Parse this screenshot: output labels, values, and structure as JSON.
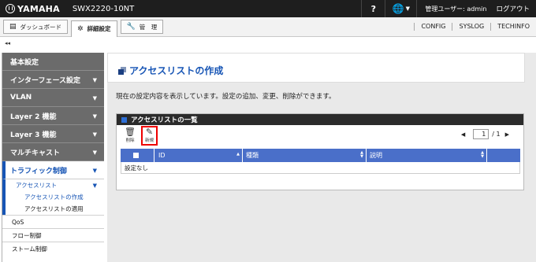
{
  "header": {
    "brand": "YAMAHA",
    "model": "SWX2220-10NT",
    "help": "?",
    "user_label": "管理ユーザー: admin",
    "logout": "ログアウト"
  },
  "tabs": {
    "dashboard": "ダッシュボード",
    "detail": "詳細設定",
    "manage": "管　理",
    "links": [
      "CONFIG",
      "SYSLOG",
      "TECHINFO"
    ]
  },
  "collapse": "◂◂",
  "sidebar": {
    "sections": [
      "基本設定",
      "インターフェース設定",
      "VLAN",
      "Layer 2 機能",
      "Layer 3 機能",
      "マルチキャスト"
    ],
    "open_section": "トラフィック制御",
    "sub_open": "アクセスリスト",
    "leaf_current": "アクセスリストの作成",
    "leaf_other": "アクセスリストの適用",
    "items": [
      "QoS",
      "フロー制御",
      "ストーム制御"
    ]
  },
  "main": {
    "title": "アクセスリストの作成",
    "description": "現在の設定内容を表示しています。設定の追加、変更、削除ができます。",
    "list_title": "アクセスリストの一覧",
    "delete_label": "削除",
    "new_label": "新規",
    "pager": {
      "current": "1",
      "total": "/ 1"
    },
    "columns": [
      "ID",
      "種類",
      "説明"
    ],
    "empty": "設定なし"
  }
}
